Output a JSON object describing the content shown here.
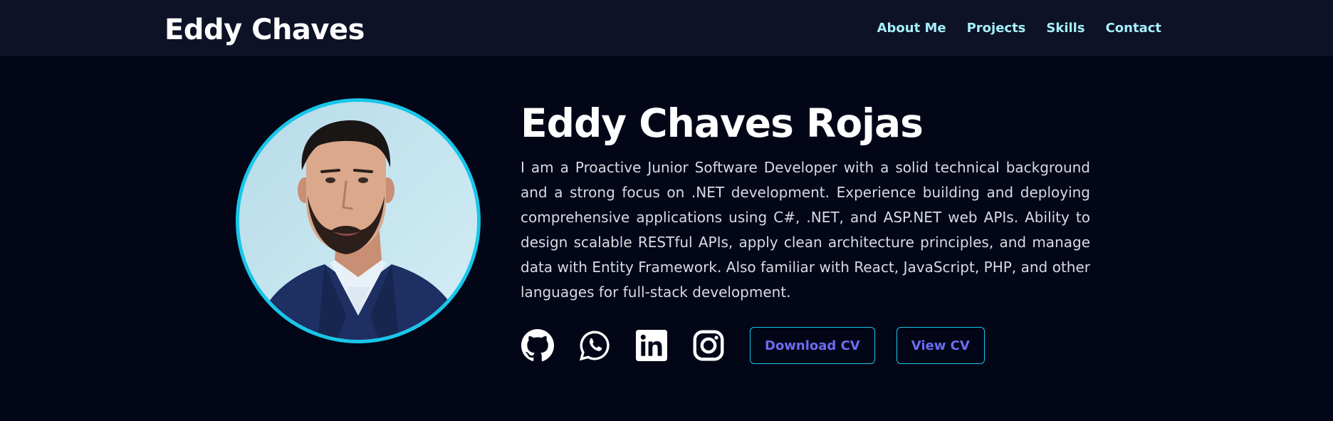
{
  "header": {
    "brand": "Eddy Chaves",
    "nav": [
      {
        "label": "About Me"
      },
      {
        "label": "Projects"
      },
      {
        "label": "Skills"
      },
      {
        "label": "Contact"
      }
    ]
  },
  "hero": {
    "name": "Eddy Chaves Rojas",
    "bio": "I am a Proactive Junior Software Developer with a solid technical background and a strong focus on .NET development. Experience building and deploying comprehensive applications using C#, .NET, and ASP.NET web APIs. Ability to design scalable RESTful APIs, apply clean architecture principles, and manage data with Entity Framework. Also familiar with React, JavaScript, PHP, and other languages for full-stack development.",
    "social": [
      {
        "icon": "github-icon"
      },
      {
        "icon": "whatsapp-icon"
      },
      {
        "icon": "linkedin-icon"
      },
      {
        "icon": "instagram-icon"
      }
    ],
    "download_cv_label": "Download CV",
    "view_cv_label": "View CV"
  },
  "colors": {
    "background": "#030617",
    "navbar": "#0d1226",
    "nav_link": "#a5f0fb",
    "accent_border": "#18c6e9",
    "button_text": "#6b6cf3"
  }
}
